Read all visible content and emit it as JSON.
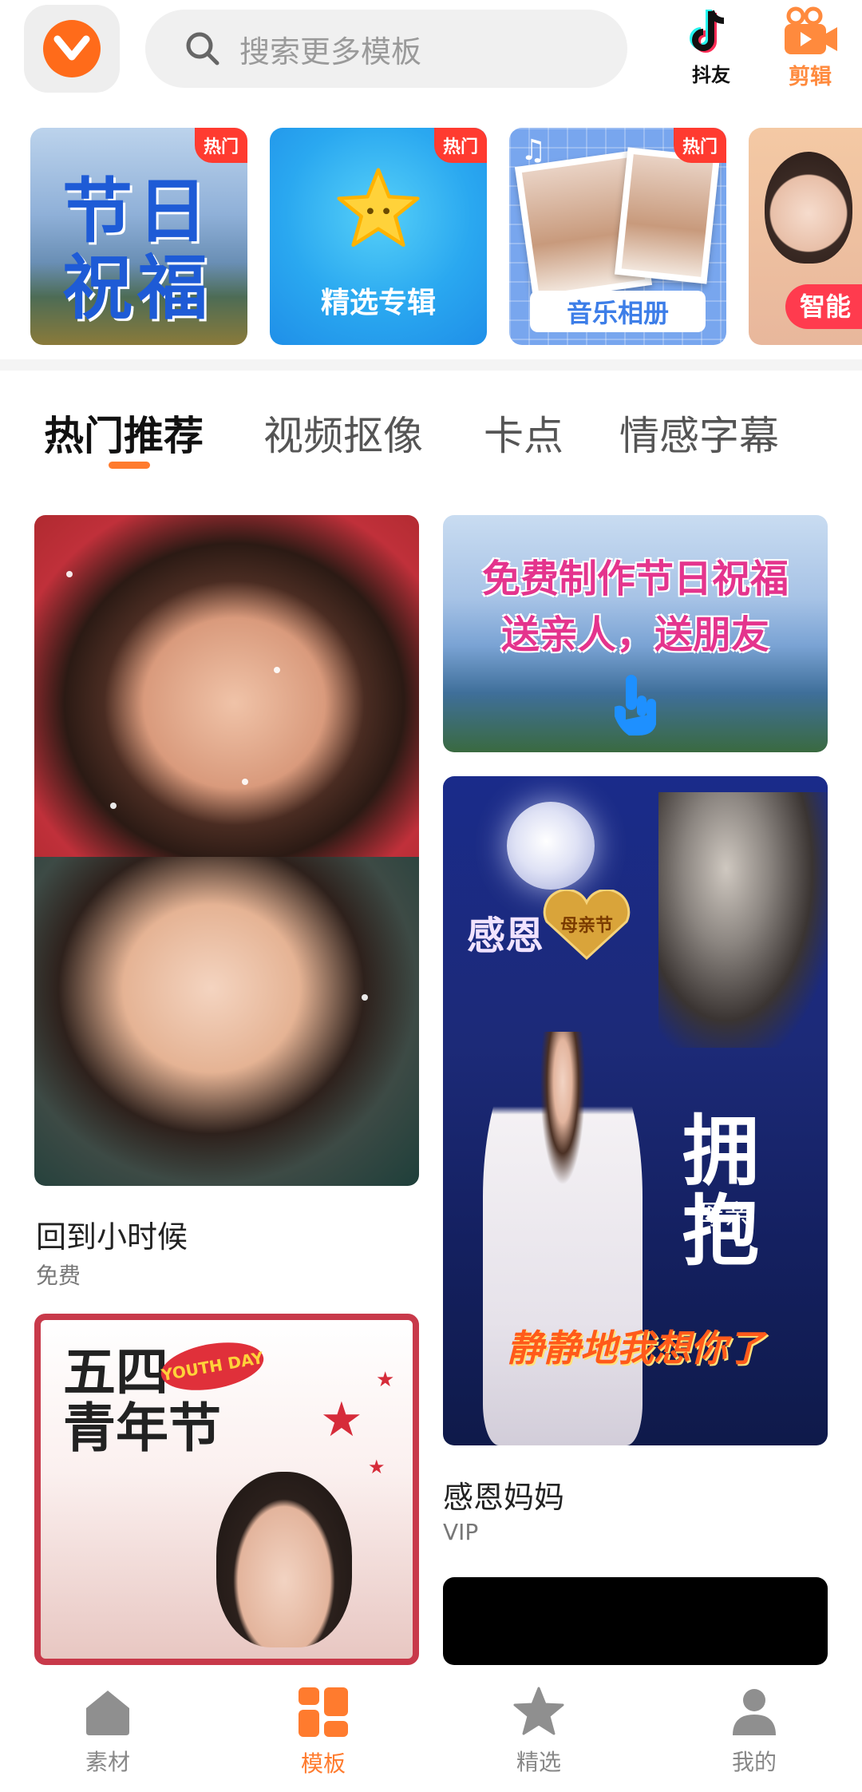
{
  "header": {
    "search_placeholder": "搜索更多模板",
    "douyin_label": "抖友",
    "jianji_label": "剪辑"
  },
  "banners": [
    {
      "title_line1": "节日",
      "title_line2": "祝福",
      "badge": "热门"
    },
    {
      "caption": "精选专辑",
      "badge": "热门"
    },
    {
      "caption": "音乐相册",
      "badge": "热门"
    },
    {
      "caption": "智能"
    }
  ],
  "tabs": [
    "热门推荐",
    "视频抠像",
    "卡点",
    "情感字幕"
  ],
  "active_tab": "热门推荐",
  "feed": {
    "card1": {
      "title": "回到小时候",
      "subtitle": "免费"
    },
    "card2": {
      "line1": "免费制作节日祝福",
      "line2": "送亲人，送朋友"
    },
    "card3": {
      "headline_line1": "五四",
      "headline_line2": "青年节",
      "badge": "YOUTH DAY"
    },
    "card4": {
      "title": "感恩妈妈",
      "subtitle": "VIP",
      "overlay_ganen": "感恩",
      "overlay_heart": "母亲节",
      "overlay_hug": "拥抱",
      "overlay_mother": "母亲",
      "overlay_miss": "静静地我想你了"
    }
  },
  "bottom_nav": [
    {
      "label": "素材",
      "icon": "home-icon"
    },
    {
      "label": "模板",
      "icon": "template-grid-icon"
    },
    {
      "label": "精选",
      "icon": "star-icon"
    },
    {
      "label": "我的",
      "icon": "profile-icon"
    }
  ],
  "active_nav": "模板",
  "colors": {
    "accent": "#ff7b2e",
    "hot_badge": "#ff3b30"
  }
}
